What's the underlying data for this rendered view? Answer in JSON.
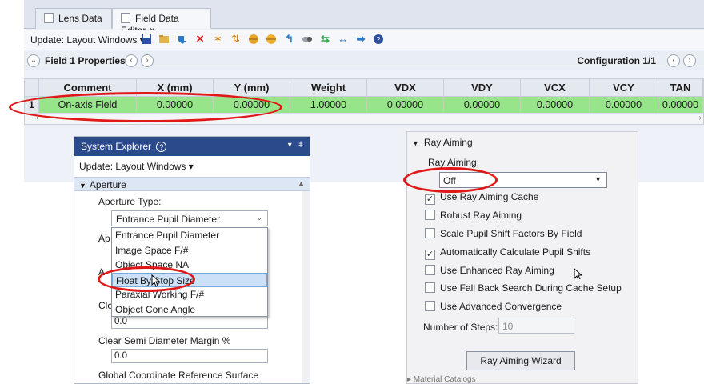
{
  "editor": {
    "tabs": [
      {
        "label": "Lens Data"
      },
      {
        "label": "Field Data Editor",
        "close": "×"
      }
    ],
    "toolbar": {
      "update_label": "Update: Layout Windows ▾",
      "icons": [
        "save-icon",
        "open-folder-icon",
        "insert-icon",
        "delete-icon",
        "wand-icon",
        "sort-icon",
        "sphere-icon",
        "sphere-icon-2",
        "arrow-icon",
        "toggle-icon",
        "swap-icon",
        "expand-icon",
        "right-arrow-icon",
        "help-icon"
      ]
    },
    "field_bar": {
      "title": "Field  1 Properties",
      "configuration": "Configuration 1/1"
    },
    "grid": {
      "columns": [
        "Comment",
        "X (mm)",
        "Y (mm)",
        "Weight",
        "VDX",
        "VDY",
        "VCX",
        "VCY",
        "TAN"
      ],
      "rows": [
        {
          "num": "1",
          "cells": [
            "On-axis Field",
            "0.00000",
            "0.00000",
            "1.00000",
            "0.00000",
            "0.00000",
            "0.00000",
            "0.00000",
            "0.00000"
          ]
        }
      ]
    }
  },
  "system_explorer": {
    "title": "System Explorer",
    "title_help": "?",
    "update_label": "Update: Layout Windows ▾",
    "section": "Aperture",
    "aperture_type_label": "Aperture Type:",
    "aperture_type_value": "Entrance Pupil Diameter",
    "partial_labels": [
      "Ap",
      "A",
      "Cle"
    ],
    "options": [
      "Entrance Pupil Diameter",
      "Image Space F/#",
      "Object Space NA",
      "Float By Stop Size",
      "Paraxial Working F/#",
      "Object Cone Angle"
    ],
    "selected_option_index": 3,
    "field_value_1": "0.0",
    "margin_label": "Clear Semi Diameter Margin %",
    "margin_value": "0.0",
    "global_ref_label": "Global Coordinate Reference Surface"
  },
  "ray_aiming": {
    "section": "Ray Aiming",
    "label": "Ray Aiming:",
    "value": "Off",
    "checkboxes": [
      {
        "label": "Use Ray Aiming Cache",
        "checked": true
      },
      {
        "label": "Robust Ray Aiming",
        "checked": false
      },
      {
        "label": "Scale Pupil Shift Factors By Field",
        "checked": false
      },
      {
        "label": "Automatically Calculate Pupil Shifts",
        "checked": true
      },
      {
        "label": "Use Enhanced Ray Aiming",
        "checked": false
      },
      {
        "label": "Use Fall Back Search During Cache Setup",
        "checked": false
      },
      {
        "label": "Use Advanced Convergence",
        "checked": false
      }
    ],
    "steps_label": "Number of Steps:",
    "steps_value": "10",
    "wizard_label": "Ray Aiming Wizard",
    "bottom_partial": "▸ Material Catalogs"
  },
  "colors": {
    "annotation_ring": "#e01818",
    "row_highlight": "#97e48a",
    "title_bar": "#2b4a8c"
  }
}
